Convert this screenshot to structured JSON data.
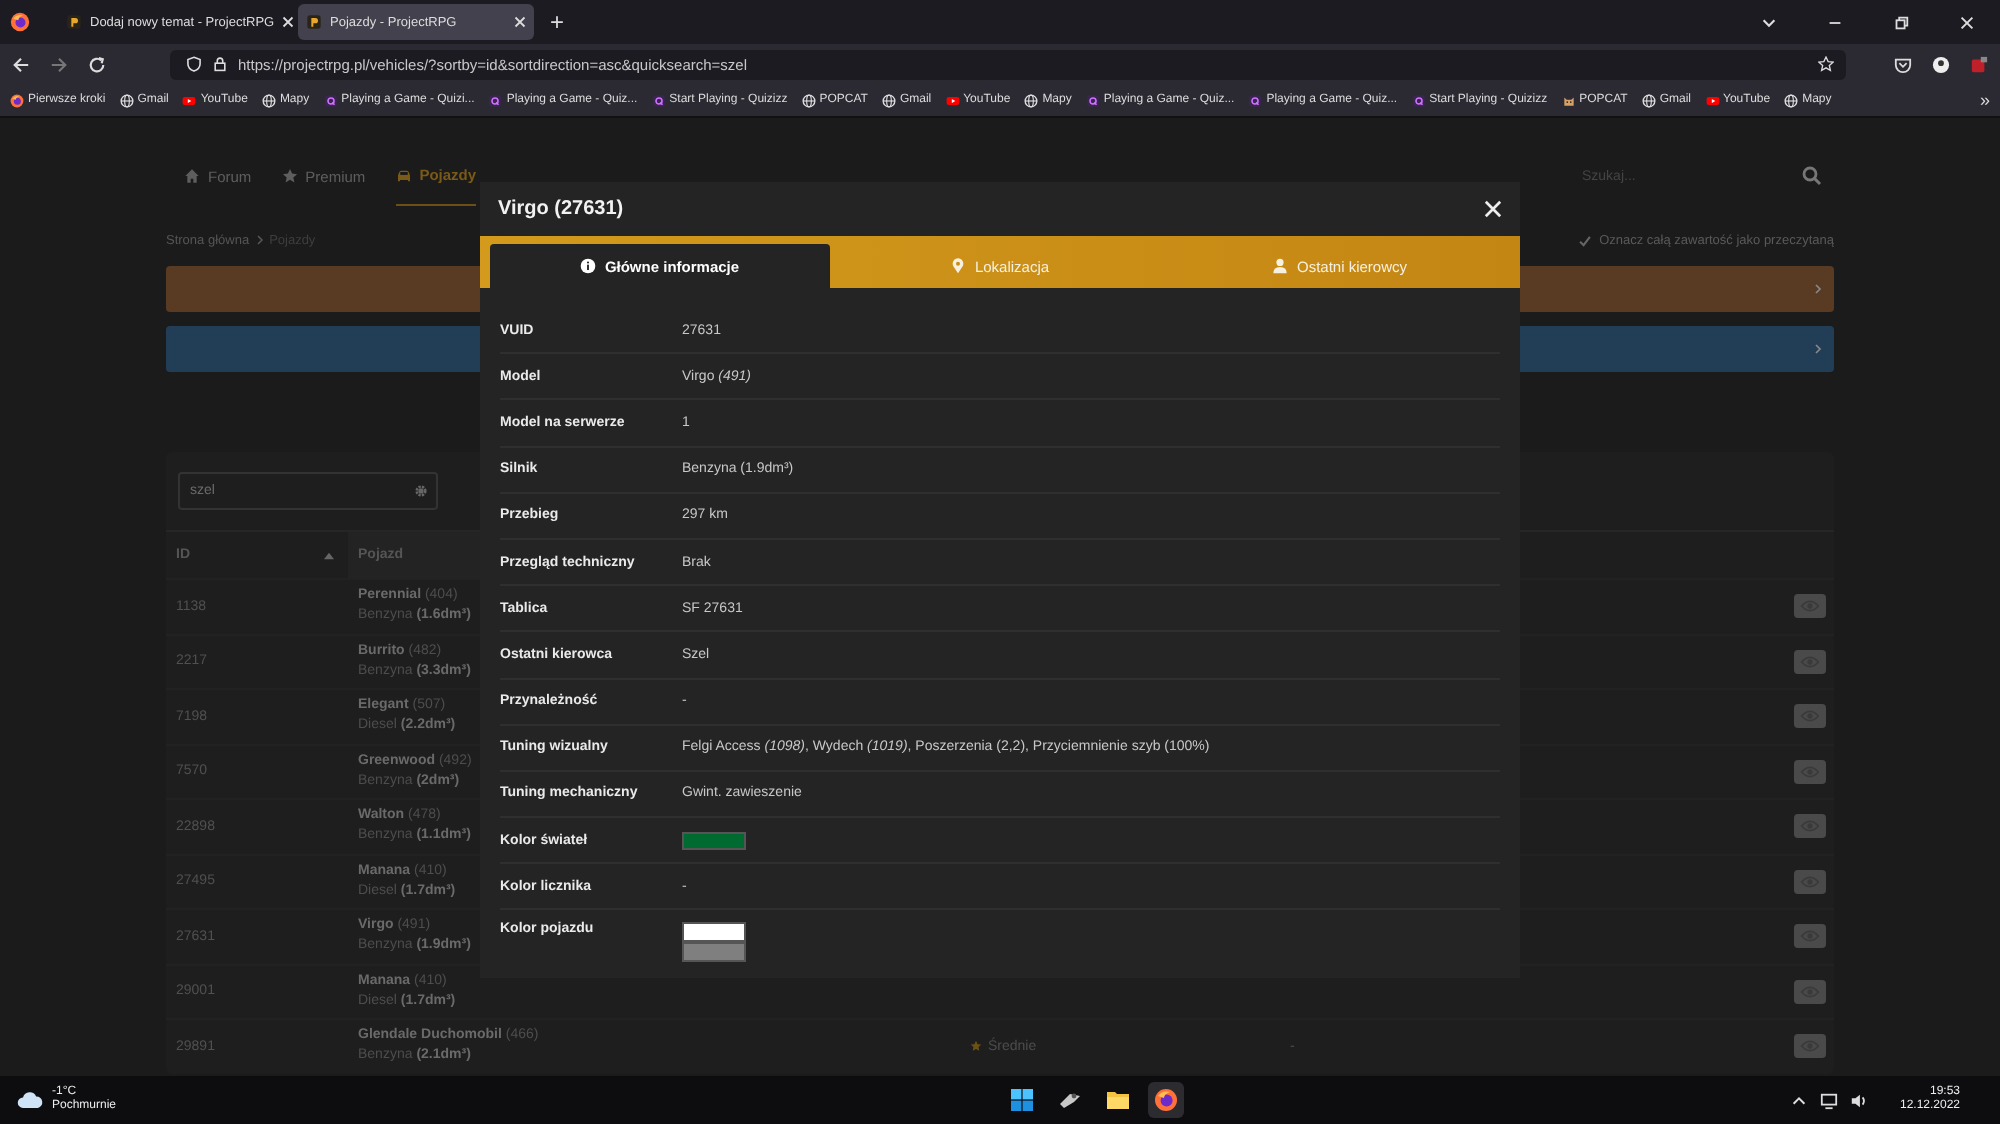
{
  "browser": {
    "tabs": [
      {
        "title": "Dodaj nowy temat - ProjectRPG",
        "selected": false
      },
      {
        "title": "Pojazdy - ProjectRPG",
        "selected": true
      }
    ],
    "new_tab": "+",
    "url": "https://projectrpg.pl/vehicles/?sortby=id&sortdirection=asc&quicksearch=szel",
    "bookmarks": [
      {
        "label": "Pierwsze kroki",
        "kind": "firefox"
      },
      {
        "label": "Gmail",
        "kind": "globe"
      },
      {
        "label": "YouTube",
        "kind": "youtube"
      },
      {
        "label": "Mapy",
        "kind": "globe"
      },
      {
        "label": "Playing a Game - Quizi...",
        "kind": "quizizz"
      },
      {
        "label": "Playing a Game - Quiz...",
        "kind": "quizizz"
      },
      {
        "label": "Start Playing - Quizizz",
        "kind": "quizizz"
      },
      {
        "label": "POPCAT",
        "kind": "globe"
      },
      {
        "label": "Gmail",
        "kind": "globe"
      },
      {
        "label": "YouTube",
        "kind": "youtube"
      },
      {
        "label": "Mapy",
        "kind": "globe"
      },
      {
        "label": "Playing a Game - Quiz...",
        "kind": "quizizz"
      },
      {
        "label": "Playing a Game - Quiz...",
        "kind": "quizizz"
      },
      {
        "label": "Start Playing - Quizizz",
        "kind": "quizizz"
      },
      {
        "label": "POPCAT",
        "kind": "cat"
      },
      {
        "label": "Gmail",
        "kind": "globe"
      },
      {
        "label": "YouTube",
        "kind": "youtube"
      },
      {
        "label": "Mapy",
        "kind": "globe"
      }
    ],
    "bookmarks_more": "»"
  },
  "site": {
    "nav": [
      {
        "label": "Forum",
        "kind": "home",
        "selected": false
      },
      {
        "label": "Premium",
        "kind": "star",
        "selected": false
      },
      {
        "label": "Pojazdy",
        "kind": "car",
        "selected": true
      }
    ],
    "search_placeholder": "Szukaj...",
    "breadcrumb": [
      "Strona główna",
      "Pojazdy"
    ],
    "mark_read": "Oznacz całą zawartość jako przeczytaną",
    "banners": [
      {
        "color": "#593a22"
      },
      {
        "color": "#223e57"
      }
    ]
  },
  "table": {
    "search": "szel",
    "columns": [
      "ID",
      "Pojazd"
    ],
    "rows": [
      {
        "id": "1138",
        "vehicle": "**Perennial** (404)",
        "engine": "Benzyna **(1.6dm³)**"
      },
      {
        "id": "2217",
        "vehicle": "**Burrito** (482)",
        "engine": "Benzyna **(3.3dm³)**"
      },
      {
        "id": "7198",
        "vehicle": "**Elegant** (507)",
        "engine": "Diesel **(2.2dm³)**"
      },
      {
        "id": "7570",
        "vehicle": "**Greenwood** (492)",
        "engine": "Benzyna **(2dm³)**"
      },
      {
        "id": "22898",
        "vehicle": "**Walton** (478)",
        "engine": "Benzyna **(1.1dm³)**"
      },
      {
        "id": "27495",
        "vehicle": "**Manana** (410)",
        "engine": "Diesel **(1.7dm³)**"
      },
      {
        "id": "27631",
        "vehicle": "**Virgo** (491)",
        "engine": "Benzyna **(1.9dm³)**"
      },
      {
        "id": "29001",
        "vehicle": "**Manana** (410)",
        "engine": "Diesel **(1.7dm³)**"
      },
      {
        "id": "29891",
        "vehicle": "**Glendale Duchomobil** (466)",
        "engine": "Benzyna **(2.1dm³)**",
        "column_3": "Średnie",
        "column_4": "-"
      }
    ]
  },
  "modal": {
    "title": "Virgo (27631)",
    "tabs": [
      {
        "label": "Główne informacje",
        "kind": "info",
        "selected": true
      },
      {
        "label": "Lokalizacja",
        "kind": "pin",
        "selected": false
      },
      {
        "label": "Ostatni kierowcy",
        "kind": "person",
        "selected": false
      }
    ],
    "details": [
      {
        "label": "VUID",
        "kind": "text",
        "value": "27631"
      },
      {
        "label": "Model",
        "kind": "text",
        "value": "Virgo *(491)*"
      },
      {
        "label": "Model na serwerze",
        "kind": "text",
        "value": "1"
      },
      {
        "label": "Silnik",
        "kind": "text",
        "value": "Benzyna (1.9dm³)"
      },
      {
        "label": "Przebieg",
        "kind": "text",
        "value": "297 km"
      },
      {
        "label": "Przegląd techniczny",
        "kind": "text",
        "value": "Brak"
      },
      {
        "label": "Tablica",
        "kind": "text",
        "value": "SF 27631"
      },
      {
        "label": "Ostatni kierowca",
        "kind": "text",
        "value": "Szel"
      },
      {
        "label": "Przynależność",
        "kind": "text",
        "value": "-"
      },
      {
        "label": "Tuning wizualny",
        "kind": "text",
        "value": "Felgi Access *(1098)*, Wydech *(1019)*, Poszerzenia (2,2), Przyciemnienie szyb (100%)"
      },
      {
        "label": "Tuning mechaniczny",
        "kind": "text",
        "value": "Gwint. zawieszenie"
      },
      {
        "label": "Kolor świateł",
        "kind": "swatch",
        "colors": [
          {
            "color": "#006b30"
          }
        ]
      },
      {
        "label": "Kolor licznika",
        "kind": "text",
        "value": "-"
      },
      {
        "label": "Kolor pojazdu",
        "kind": "swatch",
        "colors": [
          {
            "color": "#ffffff"
          },
          {
            "color": "#7f7f7f"
          }
        ]
      }
    ]
  },
  "taskbar": {
    "temperature": "-1°C",
    "weather": "Pochmurnie",
    "apps": [
      {
        "kind": "windows",
        "selected": false
      },
      {
        "kind": "tool",
        "selected": false
      },
      {
        "kind": "folder",
        "selected": false
      },
      {
        "kind": "firefox",
        "selected": true
      }
    ],
    "time": "19:53",
    "date": "12.12.2022"
  }
}
